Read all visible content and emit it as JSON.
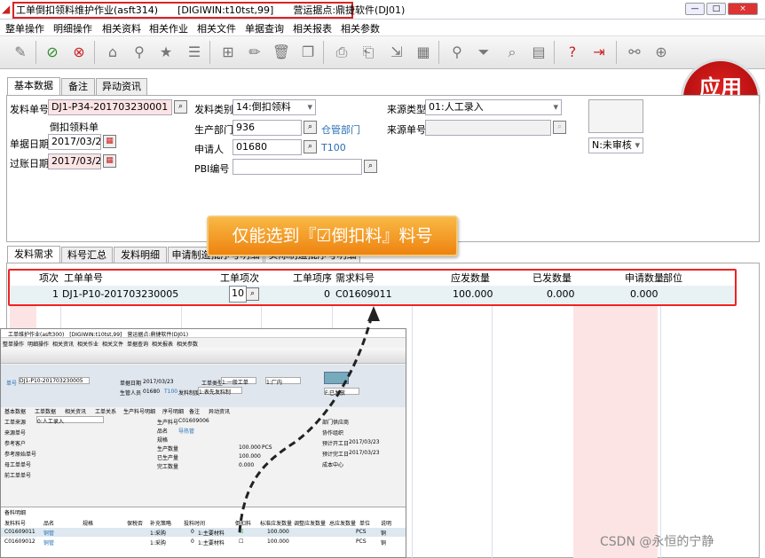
{
  "window": {
    "title": "工单倒扣领料维护作业(asft314)　　[DIGIWIN:t10tst,99]　　营运据点:鼎捷软件(DJ01)",
    "btn_min": "—",
    "btn_max": "□",
    "btn_close": "×"
  },
  "menu": [
    "整单操作",
    "明细操作",
    "相关资料",
    "相关作业",
    "相关文件",
    "单据查询",
    "相关报表",
    "相关参数"
  ],
  "apply_badge": "应用",
  "tabs": [
    "基本数据",
    "备注",
    "异动资讯"
  ],
  "form": {
    "issue_no_label": "发料单号",
    "issue_no": "DJ1-P34-201703230001",
    "issue_no_desc": "倒扣领料单",
    "doc_date_label": "单据日期",
    "doc_date": "2017/03/23",
    "post_date_label": "过账日期",
    "post_date": "2017/03/23",
    "issue_type_label": "发料类别",
    "issue_type": "14:倒扣领料",
    "dept_label": "生产部门",
    "dept": "936",
    "dept_name": "仓管部门",
    "applicant_label": "申请人",
    "applicant": "01680",
    "applicant_name": "T100",
    "pbi_label": "PBI编号",
    "pbi": "",
    "source_type_label": "来源类型",
    "source_type": "01:人工录入",
    "source_no_label": "来源单号",
    "source_no": "",
    "status": "N:未审核"
  },
  "tip": "仅能选到『☑倒扣料』料号",
  "detail_tabs": [
    "发料需求",
    "料号汇总",
    "发料明细",
    "申请制造批序号明细",
    "实际制造批序号明细"
  ],
  "grid": {
    "headers": [
      "项次",
      "工单单号",
      "工单项次",
      "工单项序",
      "需求料号",
      "应发数量",
      "已发数量",
      "申请数量",
      "部位"
    ],
    "rows": [
      {
        "seq": "1",
        "wo_no": "DJ1-P10-201703230005",
        "wo_item": "10",
        "wo_order": "0",
        "item_no": "C01609011",
        "qty_due": "100.000",
        "qty_issued": "0.000",
        "qty_req": "0.000",
        "part": ""
      }
    ]
  },
  "inset": {
    "title": "工单维护作业(asft300)　[DIGIWIN:t10tst,99]　营运据点:鼎捷软件(DJ01)",
    "menu": [
      "整单操作",
      "明细操作",
      "相关资讯",
      "相关作业",
      "相关文件",
      "单据查询",
      "相关报表",
      "相关参数"
    ],
    "wo_no_label": "单号",
    "wo_no": "DJ1-P10-201703230005",
    "doc_date_label": "单据日期",
    "doc_date": "2017/03/23",
    "wo_type_label": "工单类型",
    "wo_type": "1:一般工单",
    "site_label": "1:厂内",
    "prod_dept_label": "生管人员",
    "prod_dept": "01680",
    "t100": "T100",
    "issue_ctrl_label": "发料制度",
    "issue_ctrl": "1:表先发料制",
    "status": "F:已发放",
    "tabs": [
      "基本数据",
      "工单数据",
      "相关资讯",
      "工单关系",
      "生产料号明细",
      "序号明细",
      "备注",
      "异动资讯"
    ],
    "left_fields": [
      "工单来源",
      "来源单号",
      "参考客户",
      "参考原始单号",
      "母工单单号",
      "前工单单号"
    ],
    "src": "0:人工录入",
    "item_label": "生产料号",
    "item": "C01609006",
    "name_label": "品名",
    "name": "导热管",
    "spec_label": "规格",
    "qty_label": "生产数量",
    "qty": "100.000",
    "unit": "PCS",
    "produced_label": "已生产量",
    "produced": "100.000",
    "ok_label": "完工数量",
    "ok": "0.000",
    "right_fields": [
      "部门供应商",
      "协作组织",
      "预计开工日",
      "预计完工日",
      "成本中心"
    ],
    "start": "2017/03/23",
    "end": "2017/03/23",
    "detail_tab": "备料明细",
    "detail_headers": [
      "发料料号",
      "品名",
      "规格",
      "保税否",
      "补充策略",
      "投料时间",
      "倒扣料",
      "标准应发数量",
      "调整应发数量",
      "总应发数量",
      "单位",
      "说明"
    ],
    "detail_rows": [
      [
        "C01609011",
        "铜管",
        "",
        "",
        "1:采购",
        "0",
        "1:主要材料",
        "100.000",
        "",
        "",
        "PCS",
        "铜"
      ],
      [
        "C01609012",
        "铜管",
        "",
        "",
        "1:采购",
        "0",
        "1:主要材料",
        "100.000",
        "",
        "",
        "PCS",
        "铜"
      ]
    ]
  },
  "watermark": "CSDN @永恒的宁静"
}
